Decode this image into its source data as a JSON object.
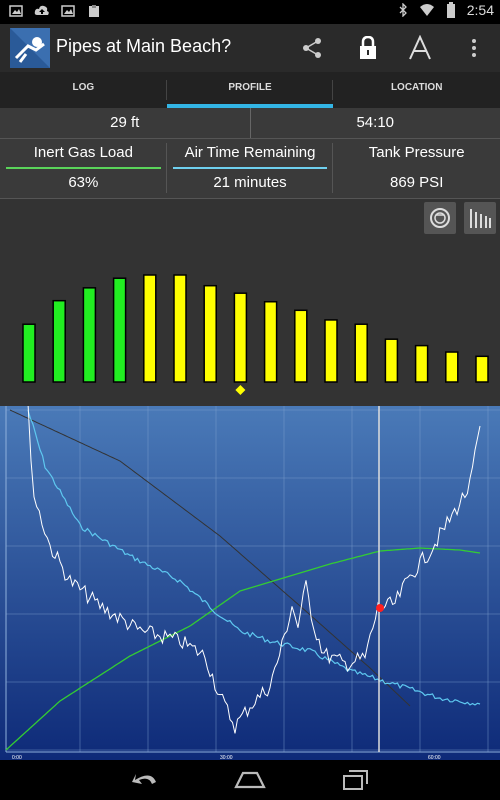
{
  "status_bar": {
    "time": "2:54"
  },
  "app": {
    "title": "Pipes at Main Beach?"
  },
  "tabs": [
    {
      "label": "LOG",
      "active": false
    },
    {
      "label": "PROFILE",
      "active": true
    },
    {
      "label": "LOCATION",
      "active": false
    }
  ],
  "summary": {
    "depth": "29 ft",
    "time": "54:10"
  },
  "metrics": [
    {
      "label": "Inert Gas Load",
      "value": "63%",
      "underline": "#5ad45a"
    },
    {
      "label": "Air Time Remaining",
      "value": "21 minutes",
      "underline": "#6fd0ef"
    },
    {
      "label": "Tank Pressure",
      "value": "869 PSI",
      "underline": "none"
    }
  ],
  "tissue_chart": {
    "bars": [
      {
        "level": 0.54,
        "color": "#22ee22"
      },
      {
        "level": 0.76,
        "color": "#22ee22"
      },
      {
        "level": 0.88,
        "color": "#22ee22"
      },
      {
        "level": 0.97,
        "color": "#22ee22"
      },
      {
        "level": 1.0,
        "color": "#ffff00"
      },
      {
        "level": 1.0,
        "color": "#ffff00"
      },
      {
        "level": 0.9,
        "color": "#ffff00"
      },
      {
        "level": 0.83,
        "color": "#ffff00"
      },
      {
        "level": 0.75,
        "color": "#ffff00"
      },
      {
        "level": 0.67,
        "color": "#ffff00"
      },
      {
        "level": 0.58,
        "color": "#ffff00"
      },
      {
        "level": 0.54,
        "color": "#ffff00"
      },
      {
        "level": 0.4,
        "color": "#ffff00"
      },
      {
        "level": 0.34,
        "color": "#ffff00"
      },
      {
        "level": 0.28,
        "color": "#ffff00"
      },
      {
        "level": 0.24,
        "color": "#ffff00"
      }
    ],
    "marker_index": 7
  },
  "profile_chart": {
    "x_ticks": [
      "0:00",
      "30:00",
      "60:00"
    ],
    "colors": {
      "depth": "#ffffff",
      "air": "#5ec8f0",
      "gas": "#33cc33",
      "ref": "#333333",
      "cursor": "#dddddd",
      "marker": "#ff2020"
    }
  }
}
